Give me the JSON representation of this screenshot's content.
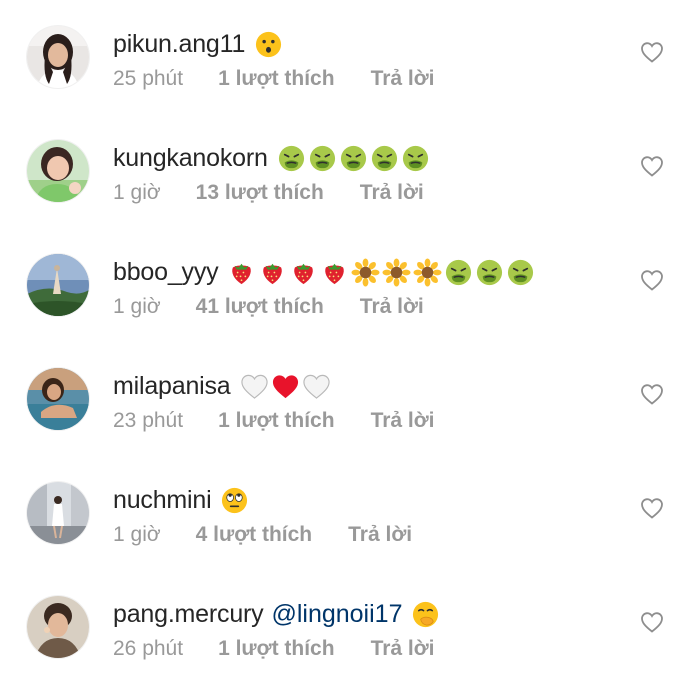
{
  "comments": [
    {
      "username": "pikun.ang11",
      "mention": "",
      "emojis": [
        "hushed-face-emoji"
      ],
      "time": "25 phút",
      "likes": "1 lượt thích",
      "reply": "Trả lời",
      "avatar": "avatar-woman-light-bg"
    },
    {
      "username": "kungkanokorn",
      "mention": "",
      "emojis": [
        "nauseated-face-emoji",
        "nauseated-face-emoji",
        "nauseated-face-emoji",
        "nauseated-face-emoji",
        "nauseated-face-emoji"
      ],
      "time": "1 giờ",
      "likes": "13 lượt thích",
      "reply": "Trả lời",
      "avatar": "avatar-woman-green-shirt"
    },
    {
      "username": "bboo_yyy",
      "mention": "",
      "emojis": [
        "strawberry-emoji",
        "strawberry-emoji",
        "strawberry-emoji",
        "strawberry-emoji",
        "sunflower-emoji",
        "sunflower-emoji",
        "sunflower-emoji",
        "nauseated-face-emoji",
        "nauseated-face-emoji",
        "nauseated-face-emoji"
      ],
      "time": "1 giờ",
      "likes": "41 lượt thích",
      "reply": "Trả lời",
      "avatar": "avatar-landscape"
    },
    {
      "username": "milapanisa",
      "mention": "",
      "emojis": [
        "white-heart-emoji",
        "red-heart-emoji",
        "white-heart-emoji"
      ],
      "time": "23 phút",
      "likes": "1 lượt thích",
      "reply": "Trả lời",
      "avatar": "avatar-woman-pool"
    },
    {
      "username": "nuchmini",
      "mention": "",
      "emojis": [
        "rolling-eyes-emoji"
      ],
      "time": "1 giờ",
      "likes": "4 lượt thích",
      "reply": "Trả lời",
      "avatar": "avatar-street-figure"
    },
    {
      "username": "pang.mercury",
      "mention": "@lingnoii17",
      "emojis": [
        "hand-over-mouth-emoji"
      ],
      "time": "26 phút",
      "likes": "1 lượt thích",
      "reply": "Trả lời",
      "avatar": "avatar-woman-updo"
    }
  ],
  "colors": {
    "username": "#262626",
    "mention": "#003569",
    "meta": "#999999",
    "heart_outline": "#8e8e8e"
  }
}
